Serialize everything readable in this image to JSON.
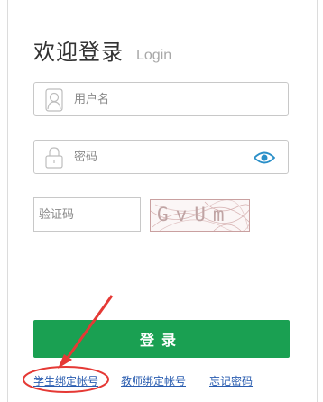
{
  "header": {
    "title": "欢迎登录",
    "subtitle": "Login"
  },
  "username": {
    "placeholder": "用户名",
    "icon": "user-icon"
  },
  "password": {
    "placeholder": "密码",
    "icon": "lock-icon",
    "toggle_icon": "eye-icon"
  },
  "captcha": {
    "placeholder": "验证码",
    "image_text": "GvUm"
  },
  "login_button": {
    "label": "登录"
  },
  "links": {
    "student_bind": "学生绑定帐号",
    "teacher_bind": "教师绑定帐号",
    "forgot_password": "忘记密码"
  },
  "colors": {
    "primary": "#1aa052",
    "link": "#2a5db0",
    "annotation": "#e53935",
    "eye": "#2a8fc8"
  }
}
